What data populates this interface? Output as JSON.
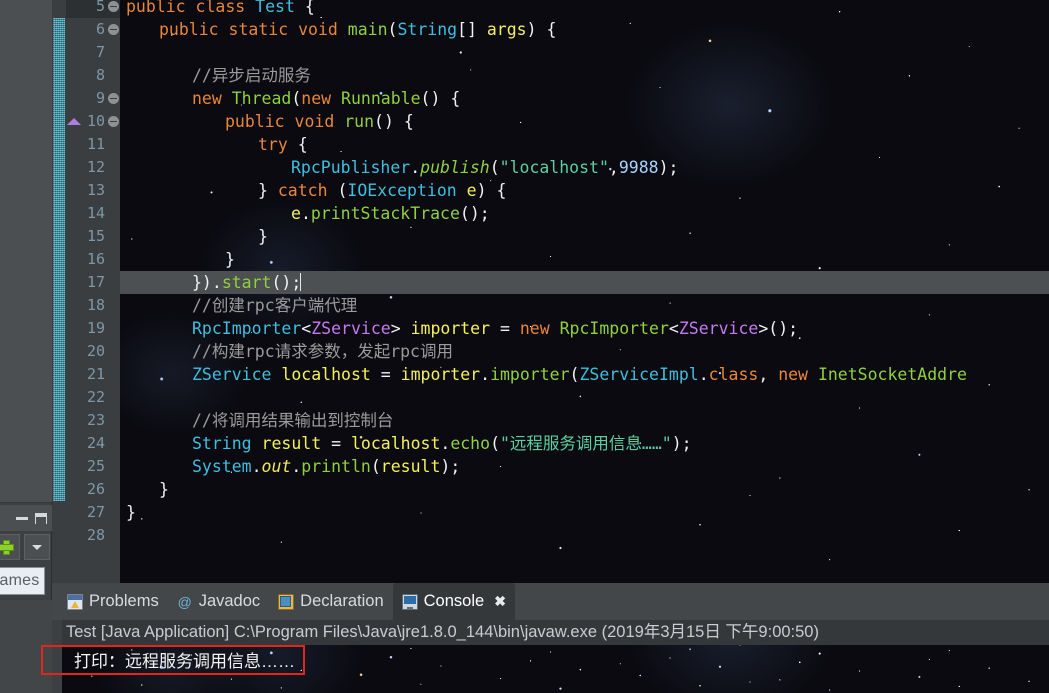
{
  "editor": {
    "first_visible_partial_line": "4",
    "current_line": 17,
    "lines": [
      {
        "n": "5",
        "fold": true,
        "indent": 0,
        "tokens": [
          {
            "t": "public ",
            "c": "kw"
          },
          {
            "t": "class ",
            "c": "kw"
          },
          {
            "t": "Test",
            "c": "typ"
          },
          {
            "t": " {",
            "c": "pun"
          }
        ]
      },
      {
        "n": "6",
        "fold": true,
        "indent": 1,
        "tokens": [
          {
            "t": "public ",
            "c": "kw"
          },
          {
            "t": "static ",
            "c": "kw"
          },
          {
            "t": "void ",
            "c": "kw"
          },
          {
            "t": "main",
            "c": "mth"
          },
          {
            "t": "(",
            "c": "pun"
          },
          {
            "t": "String",
            "c": "typ"
          },
          {
            "t": "[] ",
            "c": "pun"
          },
          {
            "t": "args",
            "c": "var"
          },
          {
            "t": ") {",
            "c": "pun"
          }
        ]
      },
      {
        "n": "7",
        "fold": false,
        "indent": 0,
        "tokens": []
      },
      {
        "n": "8",
        "fold": false,
        "indent": 2,
        "tokens": [
          {
            "t": "//异步启动服务",
            "c": "cmt"
          }
        ]
      },
      {
        "n": "9",
        "fold": true,
        "indent": 2,
        "tokens": [
          {
            "t": "new ",
            "c": "kw"
          },
          {
            "t": "Thread",
            "c": "mth"
          },
          {
            "t": "(",
            "c": "pun"
          },
          {
            "t": "new ",
            "c": "kw"
          },
          {
            "t": "Runnable",
            "c": "mth"
          },
          {
            "t": "() {",
            "c": "pun"
          }
        ]
      },
      {
        "n": "10",
        "fold": true,
        "indent": 3,
        "breakpoint": true,
        "tokens": [
          {
            "t": "public ",
            "c": "kw"
          },
          {
            "t": "void ",
            "c": "kw"
          },
          {
            "t": "run",
            "c": "mth"
          },
          {
            "t": "() {",
            "c": "pun"
          }
        ]
      },
      {
        "n": "11",
        "fold": false,
        "indent": 4,
        "tokens": [
          {
            "t": "try",
            "c": "kw"
          },
          {
            "t": " {",
            "c": "pun"
          }
        ]
      },
      {
        "n": "12",
        "fold": false,
        "indent": 5,
        "tokens": [
          {
            "t": "RpcPublisher",
            "c": "typ"
          },
          {
            "t": ".",
            "c": "pun"
          },
          {
            "t": "publish",
            "c": "mthi"
          },
          {
            "t": "(",
            "c": "pun"
          },
          {
            "t": "\"localhost\"",
            "c": "str"
          },
          {
            "t": ",",
            "c": "pun"
          },
          {
            "t": "9988",
            "c": "num"
          },
          {
            "t": ");",
            "c": "pun"
          }
        ]
      },
      {
        "n": "13",
        "fold": false,
        "indent": 4,
        "tokens": [
          {
            "t": "} ",
            "c": "pun"
          },
          {
            "t": "catch ",
            "c": "kw"
          },
          {
            "t": "(",
            "c": "pun"
          },
          {
            "t": "IOException",
            "c": "typ"
          },
          {
            "t": " ",
            "c": "pun"
          },
          {
            "t": "e",
            "c": "var"
          },
          {
            "t": ") {",
            "c": "pun"
          }
        ]
      },
      {
        "n": "14",
        "fold": false,
        "indent": 5,
        "tokens": [
          {
            "t": "e",
            "c": "var"
          },
          {
            "t": ".",
            "c": "pun"
          },
          {
            "t": "printStackTrace",
            "c": "mth"
          },
          {
            "t": "();",
            "c": "pun"
          }
        ]
      },
      {
        "n": "15",
        "fold": false,
        "indent": 4,
        "tokens": [
          {
            "t": "}",
            "c": "pun"
          }
        ]
      },
      {
        "n": "16",
        "fold": false,
        "indent": 3,
        "tokens": [
          {
            "t": "}",
            "c": "pun"
          }
        ]
      },
      {
        "n": "17",
        "fold": false,
        "indent": 2,
        "current": true,
        "caret": true,
        "tokens": [
          {
            "t": "}).",
            "c": "pun"
          },
          {
            "t": "start",
            "c": "mth"
          },
          {
            "t": "();",
            "c": "pun"
          }
        ]
      },
      {
        "n": "18",
        "fold": false,
        "indent": 2,
        "tokens": [
          {
            "t": "//创建",
            "c": "cmt"
          },
          {
            "t": "rpc",
            "c": "cmt sp"
          },
          {
            "t": "客户端代理",
            "c": "cmt"
          }
        ]
      },
      {
        "n": "19",
        "fold": false,
        "indent": 2,
        "tokens": [
          {
            "t": "RpcImporter",
            "c": "typ"
          },
          {
            "t": "<",
            "c": "pun"
          },
          {
            "t": "ZService",
            "c": "gen"
          },
          {
            "t": "> ",
            "c": "pun"
          },
          {
            "t": "importer",
            "c": "var"
          },
          {
            "t": " = ",
            "c": "pun"
          },
          {
            "t": "new ",
            "c": "kw"
          },
          {
            "t": "RpcImporter",
            "c": "mth"
          },
          {
            "t": "<",
            "c": "pun"
          },
          {
            "t": "ZService",
            "c": "gen"
          },
          {
            "t": ">();",
            "c": "pun"
          }
        ]
      },
      {
        "n": "20",
        "fold": false,
        "indent": 2,
        "tokens": [
          {
            "t": "//构建",
            "c": "cmt"
          },
          {
            "t": "rpc",
            "c": "cmt sp"
          },
          {
            "t": "请求参数，发起",
            "c": "cmt"
          },
          {
            "t": "rpc",
            "c": "cmt sp"
          },
          {
            "t": "调用",
            "c": "cmt"
          }
        ]
      },
      {
        "n": "21",
        "fold": false,
        "indent": 2,
        "tokens": [
          {
            "t": "ZService",
            "c": "typ"
          },
          {
            "t": " ",
            "c": "pun"
          },
          {
            "t": "localhost",
            "c": "var"
          },
          {
            "t": " = ",
            "c": "pun"
          },
          {
            "t": "importer",
            "c": "var"
          },
          {
            "t": ".",
            "c": "pun"
          },
          {
            "t": "importer",
            "c": "mth"
          },
          {
            "t": "(",
            "c": "pun"
          },
          {
            "t": "ZServiceImpl",
            "c": "typ"
          },
          {
            "t": ".",
            "c": "pun"
          },
          {
            "t": "class",
            "c": "kw"
          },
          {
            "t": ", ",
            "c": "pun"
          },
          {
            "t": "new ",
            "c": "kw"
          },
          {
            "t": "InetSocketAddre",
            "c": "mth"
          }
        ]
      },
      {
        "n": "22",
        "fold": false,
        "indent": 0,
        "tokens": []
      },
      {
        "n": "23",
        "fold": false,
        "indent": 2,
        "tokens": [
          {
            "t": "//将调用结果输出到控制台",
            "c": "cmt"
          }
        ]
      },
      {
        "n": "24",
        "fold": false,
        "indent": 2,
        "tokens": [
          {
            "t": "String",
            "c": "typ"
          },
          {
            "t": " ",
            "c": "pun"
          },
          {
            "t": "result",
            "c": "var"
          },
          {
            "t": " = ",
            "c": "pun"
          },
          {
            "t": "localhost",
            "c": "var"
          },
          {
            "t": ".",
            "c": "pun"
          },
          {
            "t": "echo",
            "c": "mth"
          },
          {
            "t": "(",
            "c": "pun"
          },
          {
            "t": "\"远程服务调用信息……\"",
            "c": "str"
          },
          {
            "t": ");",
            "c": "pun"
          }
        ]
      },
      {
        "n": "25",
        "fold": false,
        "indent": 2,
        "tokens": [
          {
            "t": "System",
            "c": "typ"
          },
          {
            "t": ".",
            "c": "pun"
          },
          {
            "t": "out",
            "c": "fld"
          },
          {
            "t": ".",
            "c": "pun"
          },
          {
            "t": "println",
            "c": "mth"
          },
          {
            "t": "(",
            "c": "pun"
          },
          {
            "t": "result",
            "c": "var"
          },
          {
            "t": ");",
            "c": "pun"
          }
        ]
      },
      {
        "n": "26",
        "fold": false,
        "indent": 1,
        "tokens": [
          {
            "t": "}",
            "c": "pun"
          }
        ]
      },
      {
        "n": "27",
        "fold": false,
        "indent": 0,
        "tokens": [
          {
            "t": "}",
            "c": "pun"
          }
        ]
      },
      {
        "n": "28",
        "fold": false,
        "indent": 0,
        "tokens": []
      }
    ]
  },
  "left_panel": {
    "minimize_title": "Minimize",
    "maximize_title": "Maximize",
    "add_button_title": "+",
    "menu_button_title": "View Menu",
    "tooltip_text": "ames"
  },
  "bottom_view": {
    "tabs": [
      {
        "label": "Problems",
        "icon": "problems-icon",
        "active": false,
        "closable": false
      },
      {
        "label": "Javadoc",
        "icon": "javadoc-icon",
        "active": false,
        "closable": false
      },
      {
        "label": "Declaration",
        "icon": "declaration-icon",
        "active": false,
        "closable": false
      },
      {
        "label": "Console",
        "icon": "console-icon",
        "active": true,
        "closable": true
      }
    ],
    "close_glyph": "✖",
    "javadoc_glyph": "@",
    "console": {
      "header": "Test [Java Application] C:\\Program Files\\Java\\jre1.8.0_144\\bin\\javaw.exe (2019年3月15日 下午9:00:50)",
      "output_lines": [
        "打印：远程服务调用信息……"
      ]
    }
  },
  "annotation": {
    "color": "#e2261d",
    "target": "打印：远程服务调用信息……"
  },
  "colors": {
    "keyword": "#e8863a",
    "type": "#3fbfe0",
    "generic": "#c779f0",
    "method": "#8fd13e",
    "variable": "#f5f15a",
    "string": "#5ccfa0",
    "comment": "#9b9b9b",
    "punctuation": "#f2f2f2",
    "current_line_bg": "#4d5052",
    "gutter_bg": "#3b3e41",
    "annobar_thumb": "#2f94ab",
    "annotation_red": "#e2261d"
  }
}
